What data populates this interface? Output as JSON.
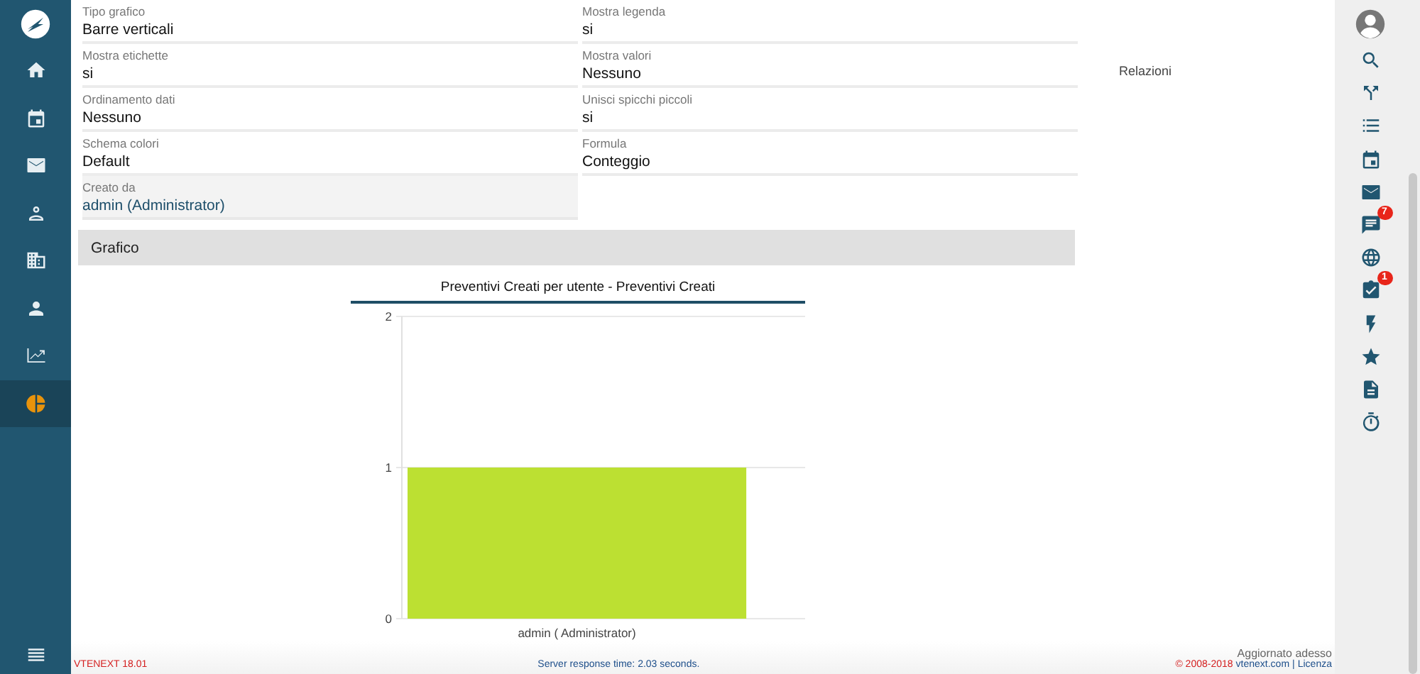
{
  "sidebar": {
    "items": [
      {
        "selected": false
      },
      {
        "selected": false
      },
      {
        "selected": false
      },
      {
        "selected": false
      },
      {
        "selected": false
      },
      {
        "selected": false
      },
      {
        "selected": false
      },
      {
        "selected": true
      }
    ]
  },
  "fields": [
    {
      "label": "Tipo grafico",
      "value": "Barre verticali",
      "kind": "text"
    },
    {
      "label": "Mostra legenda",
      "value": "si",
      "kind": "text"
    },
    {
      "label": "Mostra etichette",
      "value": "si",
      "kind": "text"
    },
    {
      "label": "Mostra valori",
      "value": "Nessuno",
      "kind": "text"
    },
    {
      "label": "Ordinamento dati",
      "value": "Nessuno",
      "kind": "text"
    },
    {
      "label": "Unisci spicchi piccoli",
      "value": "si",
      "kind": "text"
    },
    {
      "label": "Schema colori",
      "value": "Default",
      "kind": "text"
    },
    {
      "label": "Formula",
      "value": "Conteggio",
      "kind": "text"
    },
    {
      "label": "Creato da",
      "value": "admin (Administrator)",
      "kind": "link"
    }
  ],
  "related": {
    "title": "Relazioni"
  },
  "chart_section": {
    "title": "Grafico",
    "chart_data": {
      "type": "bar",
      "title": "Preventivi Creati per utente - Preventivi Creati",
      "categories": [
        "admin ( Administrator)"
      ],
      "series": [
        {
          "color": "#bce032",
          "values": [
            1
          ]
        }
      ],
      "ylim": [
        0,
        2
      ],
      "yticks": [
        0,
        1,
        2
      ]
    }
  },
  "footer": {
    "version": "VTENEXT 18.01",
    "server_time": "Server response time: 2.03 seconds.",
    "updated": "Aggiornato adesso",
    "copyright": "© 2008-2018",
    "links": [
      "vtenext.com",
      "Licenza"
    ],
    "separator": "|"
  },
  "rail": {
    "badges": [
      "7",
      "1"
    ]
  }
}
